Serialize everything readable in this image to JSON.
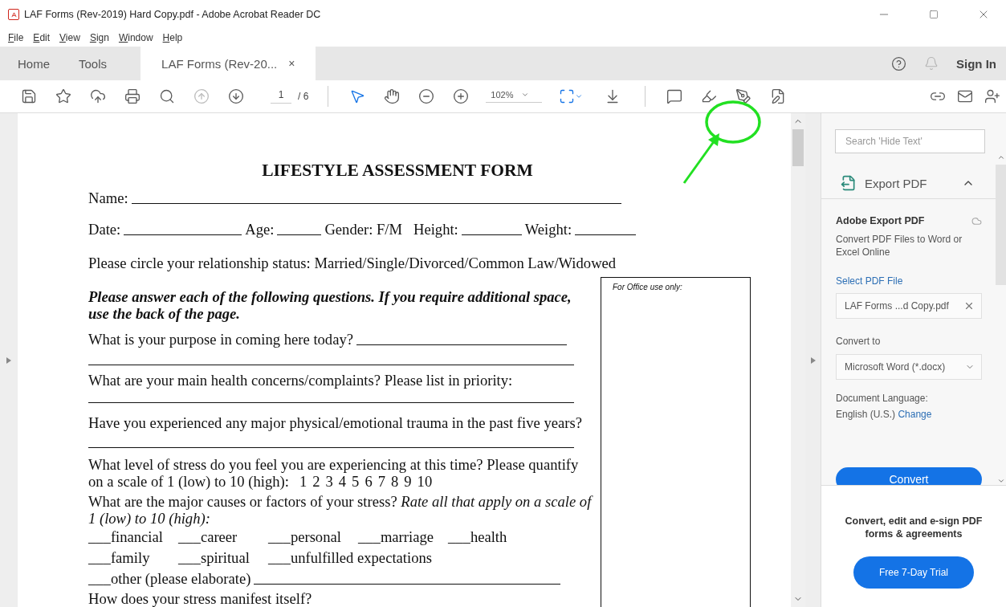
{
  "window": {
    "title": "LAF Forms (Rev-2019) Hard Copy.pdf - Adobe Acrobat Reader DC"
  },
  "menu": [
    "File",
    "Edit",
    "View",
    "Sign",
    "Window",
    "Help"
  ],
  "tabs": [
    {
      "label": "Home",
      "selected": false
    },
    {
      "label": "Tools",
      "selected": false
    },
    {
      "label": "LAF Forms (Rev-20...",
      "selected": true,
      "close": "×"
    }
  ],
  "account": {
    "sign_in": "Sign In"
  },
  "toolbar": {
    "previous_page": {
      "disabled": true
    },
    "page_number": "1",
    "page_count": "/ 6",
    "select_tool": {
      "selected": true
    },
    "hand_tool": {
      "selected": false
    },
    "zoom": "102%"
  },
  "document": {
    "title": "LIFESTYLE ASSESSMENT FORM",
    "name_label": "Name:",
    "info_labels": [
      {
        "text": "Date:",
        "blank": true
      },
      {
        "text": "Age:",
        "blank": true
      },
      {
        "text": "Gender: F/M",
        "blank": false
      },
      {
        "text": "Height:",
        "blank": true
      },
      {
        "text": "Weight:",
        "blank": true
      }
    ],
    "relationship": "Please circle your relationship status: Married/Single/Divorced/Common Law/Widowed",
    "instructions": "Please answer each of the following questions. If you require additional space, use the back of the page.",
    "office_box": "For Office use only:",
    "questions": [
      {
        "text": "What is your purpose in coming here today?",
        "inline_blank": true
      },
      {
        "text": "What are your main health concerns/complaints? Please list in priority:",
        "inline_blank": false
      },
      {
        "text": "Have you experienced any major physical/emotional trauma in the past five years?",
        "inline_blank": false
      }
    ],
    "stress_level": {
      "question": "What level of stress do you feel you are experiencing at this time? Please quantify on a scale of 1 (low) to 10 (high):",
      "scale": [
        "1",
        "2",
        "3",
        "4",
        "5",
        "6",
        "7",
        "8",
        "9",
        "10"
      ]
    },
    "stress_causes": {
      "question": "What are the major causes or factors of your stress? *Rate all that apply on a scale of 1 (low) to 10 (high):*",
      "options": [
        [
          "___financial",
          "___career",
          "___personal",
          "___marriage",
          "___health"
        ],
        [
          "___family",
          "___spiritual",
          "___unfulfilled expectations"
        ]
      ],
      "other": "___other (please elaborate)"
    },
    "last_question": "How does your stress manifest itself?"
  },
  "export_panel": {
    "search_placeholder": "Search 'Hide Text'",
    "tool": {
      "label": "Export PDF",
      "expanded": true
    },
    "heading": "Adobe Export PDF",
    "description": "Convert PDF Files to Word or Excel Online",
    "select_file_link": "Select PDF File",
    "file": "LAF Forms ...d Copy.pdf",
    "convert_to_label": "Convert to",
    "format": "Microsoft Word (*.docx)",
    "language_label": "Document Language:",
    "language": "English (U.S.)",
    "change_link": "Change",
    "convert_button": "Convert"
  },
  "promo": {
    "text": "Convert, edit and e-sign PDF forms & agreements",
    "button": "Free 7-Day Trial"
  }
}
